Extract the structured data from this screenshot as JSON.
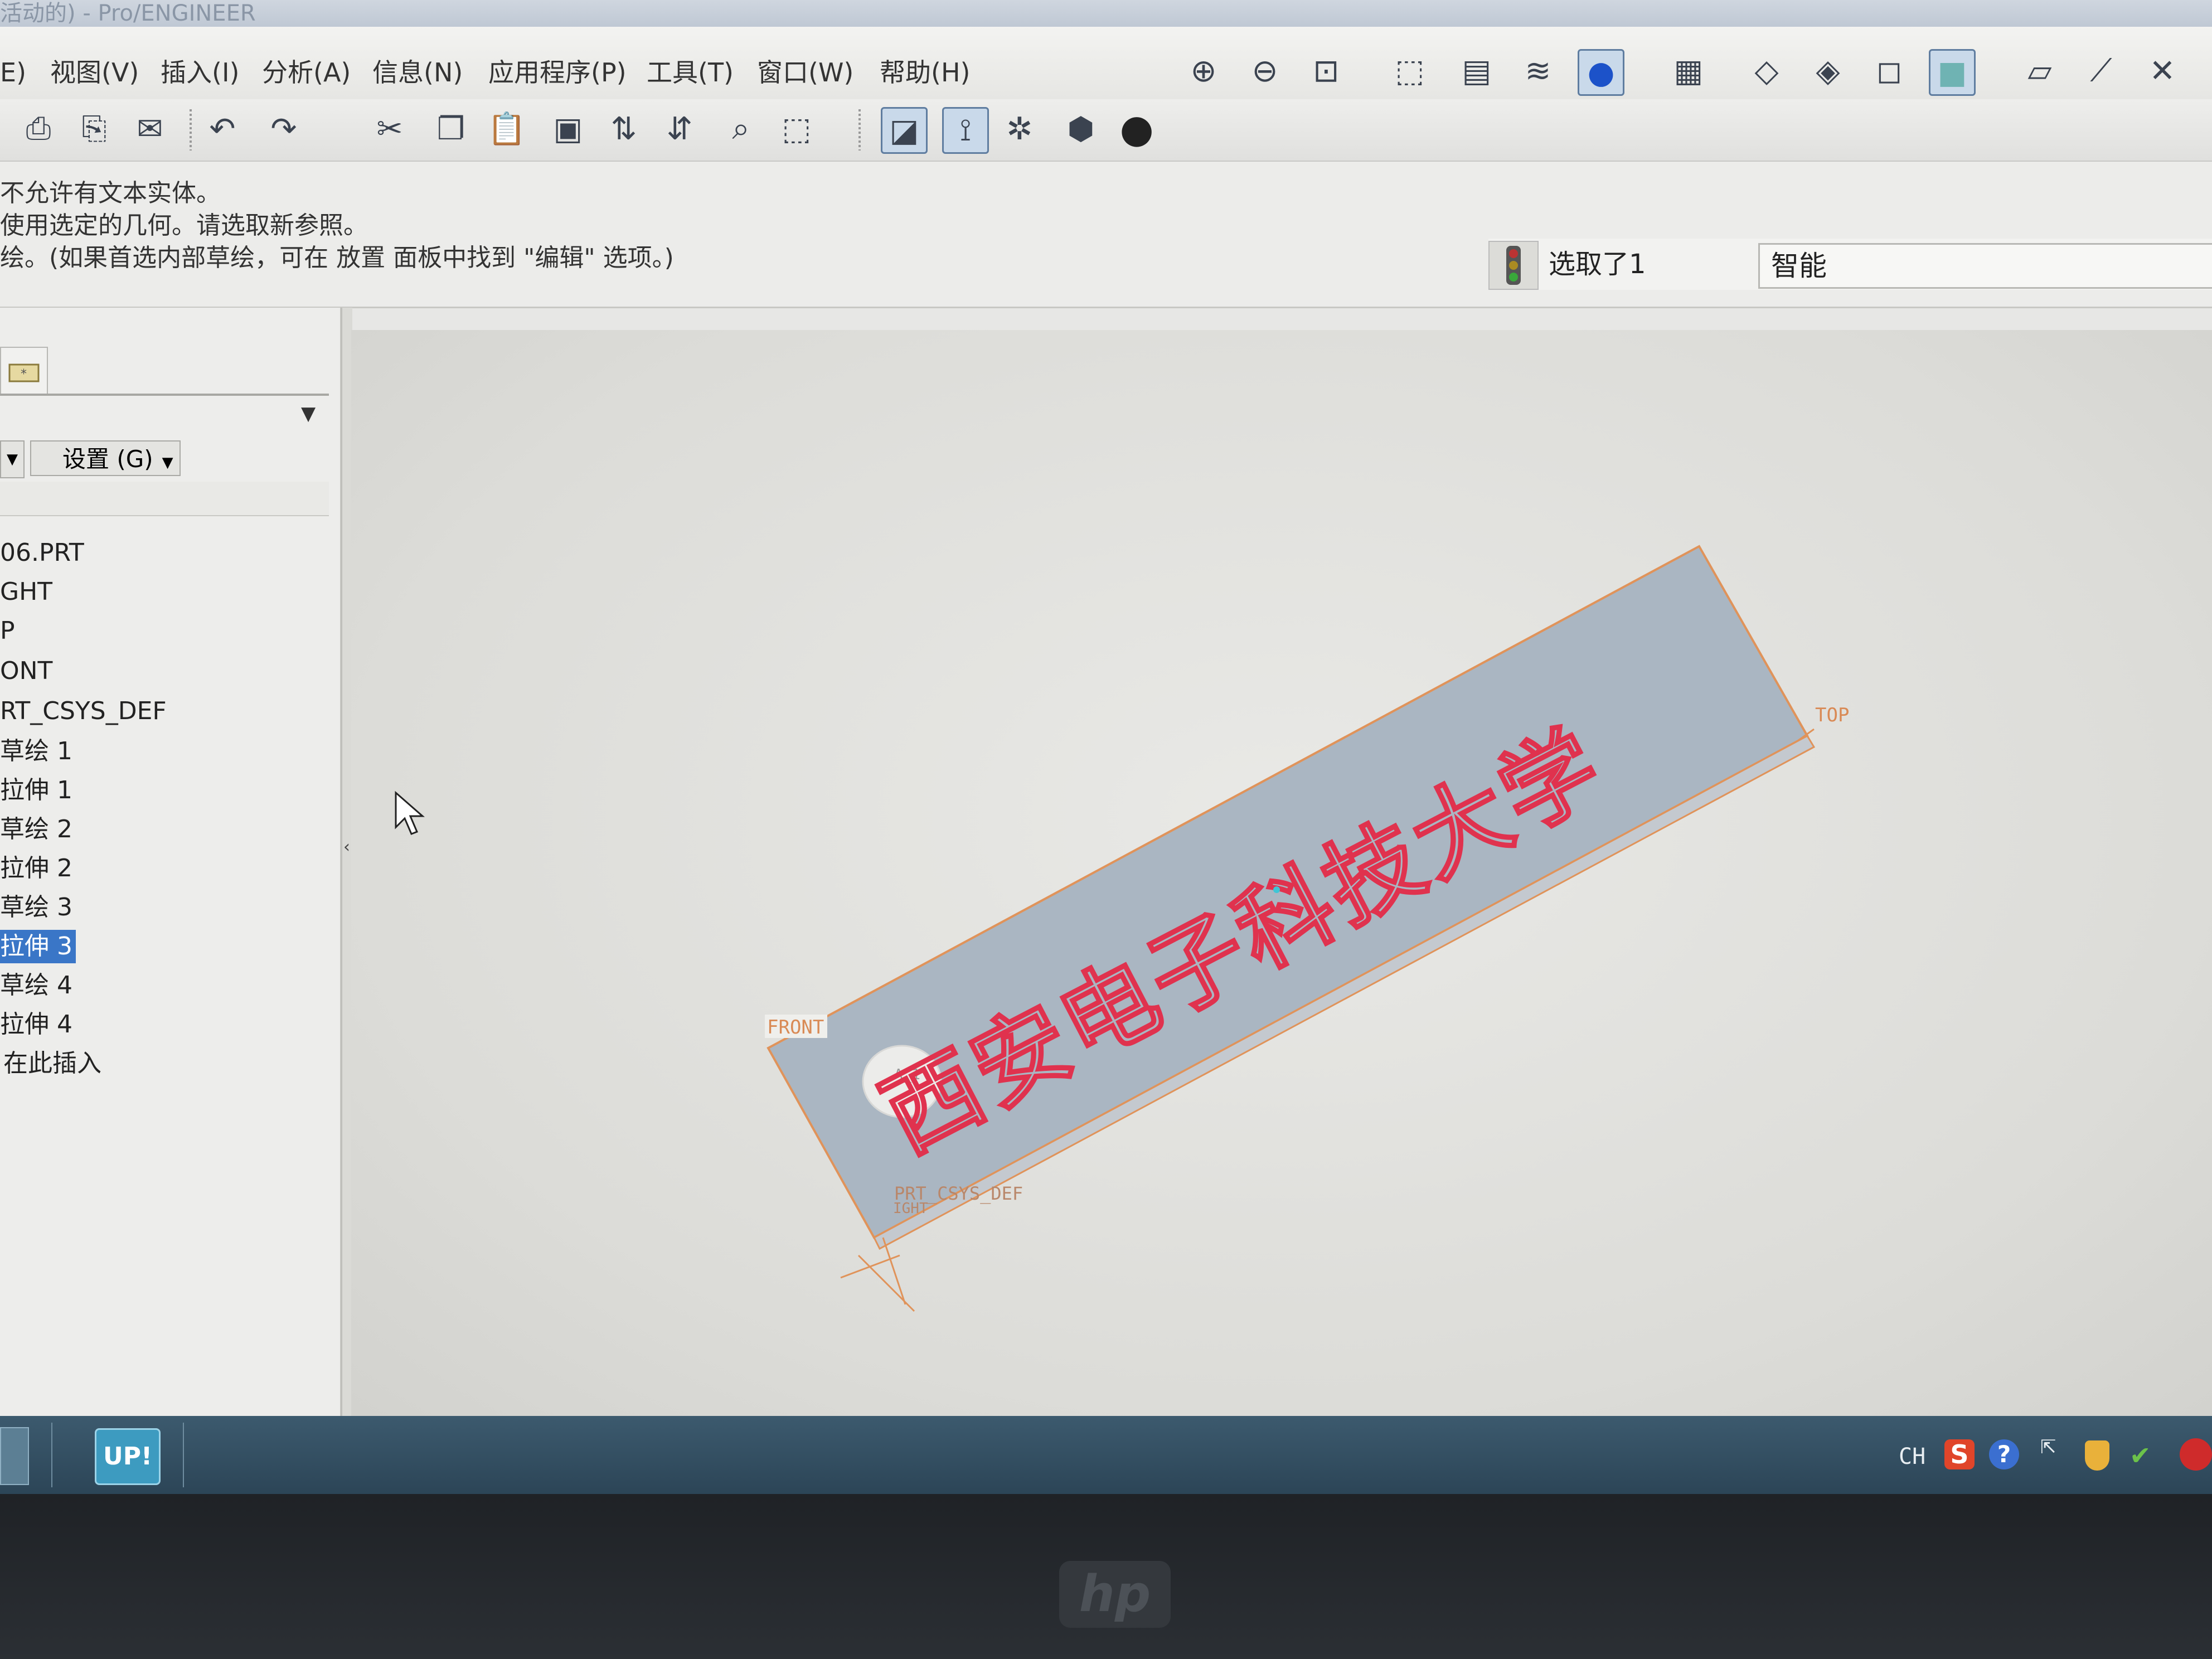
{
  "window": {
    "title": "活动的) - Pro/ENGINEER"
  },
  "menubar": {
    "items": [
      {
        "label": "E)"
      },
      {
        "label": "视图(V)"
      },
      {
        "label": "插入(I)"
      },
      {
        "label": "分析(A)"
      },
      {
        "label": "信息(N)"
      },
      {
        "label": "应用程序(P)"
      },
      {
        "label": "工具(T)"
      },
      {
        "label": "窗口(W)"
      },
      {
        "label": "帮助(H)"
      }
    ]
  },
  "messages": {
    "lines": [
      "不允许有文本实体。",
      "使用选定的几何。请选取新参照。",
      "绘。(如果首选内部草绘，可在 放置 面板中找到 \"编辑\" 选项。)"
    ]
  },
  "status": {
    "selected_text": "选取了1",
    "filter_value": "智能"
  },
  "tree": {
    "settings_label": "设置 (G)",
    "items": [
      {
        "label": "06.PRT",
        "selected": false
      },
      {
        "label": "GHT",
        "selected": false
      },
      {
        "label": "P",
        "selected": false
      },
      {
        "label": "ONT",
        "selected": false
      },
      {
        "label": "RT_CSYS_DEF",
        "selected": false
      },
      {
        "label": "草绘 1",
        "selected": false
      },
      {
        "label": "拉伸 1",
        "selected": false
      },
      {
        "label": "草绘 2",
        "selected": false
      },
      {
        "label": "拉伸 2",
        "selected": false
      },
      {
        "label": "草绘 3",
        "selected": false
      },
      {
        "label": "拉伸 3",
        "selected": true
      },
      {
        "label": "草绘 4",
        "selected": false
      },
      {
        "label": "拉伸 4",
        "selected": false
      },
      {
        "label": "在此插入",
        "selected": false
      }
    ]
  },
  "viewport": {
    "datum_labels": {
      "top": "TOP",
      "front": "FRONT",
      "csys": "PRT_CSYS_DEF",
      "axis": "A_1",
      "right": "IGHT"
    },
    "engraved_text": "西安电子科技大学",
    "colors": {
      "plate": "#aab6c2",
      "edge": "#e0935a",
      "text_outline": "#e0324e"
    }
  },
  "taskbar": {
    "up_label": "UP!",
    "lang": "CH"
  },
  "bezel": {
    "brand": "hp"
  }
}
